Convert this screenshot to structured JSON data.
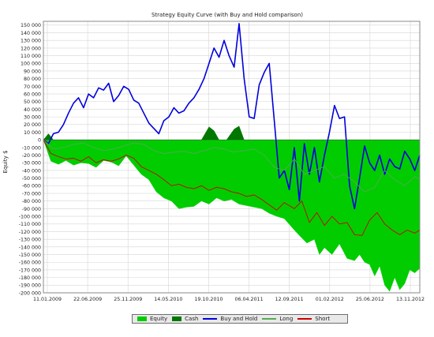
{
  "chart_data": {
    "type": "line",
    "title": "Strategy Equity Curve (with Buy and Hold comparison)",
    "ylabel": "Equity $",
    "xlabel": "",
    "ylim": [
      -200000,
      155000
    ],
    "yticks": [
      150000,
      140000,
      130000,
      120000,
      110000,
      100000,
      90000,
      80000,
      70000,
      60000,
      50000,
      40000,
      30000,
      20000,
      10000,
      0,
      -10000,
      -20000,
      -30000,
      -40000,
      -50000,
      -60000,
      -70000,
      -80000,
      -90000,
      -100000,
      -110000,
      -120000,
      -130000,
      -140000,
      -150000,
      -160000,
      -170000,
      -180000,
      -190000,
      -200000
    ],
    "ytick_labels": [
      "150 000",
      "140 000",
      "130 000",
      "120 000",
      "110 000",
      "100 000",
      "90 000",
      "80 000",
      "70 000",
      "60 000",
      "50 000",
      "40 000",
      "30 000",
      "20 000",
      "10 000",
      "0",
      "-10 000",
      "-20 000",
      "-30 000",
      "-40 000",
      "-50 000",
      "-60 000",
      "-70 000",
      "-80 000",
      "-90 000",
      "-100 000",
      "-110 000",
      "-120 000",
      "-130 000",
      "-140 000",
      "-150 000",
      "-160 000",
      "-170 000",
      "-180 000",
      "-190 000",
      "-200 000"
    ],
    "xticks": [
      "11.01.2009",
      "22.06.2009",
      "25.11.2009",
      "14.05.2010",
      "19.10.2010",
      "06.04.2011",
      "12.09.2011",
      "01.02.2012",
      "25.06.2012",
      "13.11.2012"
    ],
    "grid": true,
    "legend_position": "bottom",
    "series": [
      {
        "name": "Equity",
        "kind": "area",
        "color": "#00cc00",
        "x": [
          0,
          3,
          6,
          9,
          12,
          15,
          18,
          21,
          24,
          27,
          30,
          33,
          36,
          39,
          42,
          45,
          48,
          51,
          54,
          57,
          60,
          63,
          66,
          69,
          72,
          75,
          78,
          81,
          84,
          87,
          90,
          93,
          96,
          100,
          102,
          105,
          108,
          110,
          112,
          115,
          118,
          121,
          124,
          126,
          128,
          130,
          132,
          134,
          136,
          138,
          140,
          142,
          144,
          146,
          148,
          150
        ],
        "y": [
          0,
          -28000,
          -32000,
          -27000,
          -33000,
          -30000,
          -31000,
          -36000,
          -27000,
          -29000,
          -34000,
          -21000,
          -33000,
          -45000,
          -52000,
          -68000,
          -76000,
          -80000,
          -90000,
          -88000,
          -87000,
          -80000,
          -84000,
          -76000,
          -80000,
          -78000,
          -84000,
          -86000,
          -88000,
          -90000,
          -96000,
          -100000,
          -103000,
          -118000,
          -125000,
          -135000,
          -130000,
          -150000,
          -141000,
          -150000,
          -136000,
          -155000,
          -158000,
          -150000,
          -160000,
          -163000,
          -178000,
          -165000,
          -190000,
          -198000,
          -180000,
          -196000,
          -188000,
          -170000,
          -174000,
          -168000
        ]
      },
      {
        "name": "Cash",
        "kind": "area",
        "color": "#007700",
        "x": [
          0,
          2,
          4,
          50,
          55,
          60,
          63,
          66,
          68,
          70,
          73,
          76,
          78,
          80,
          150
        ],
        "y": [
          0,
          8000,
          0,
          0,
          0,
          0,
          0,
          17000,
          12000,
          0,
          0,
          14000,
          18000,
          0,
          0
        ]
      },
      {
        "name": "Buy and Hold",
        "kind": "line",
        "color": "#0000dd",
        "x": [
          0,
          2,
          4,
          6,
          8,
          10,
          12,
          14,
          16,
          18,
          20,
          22,
          24,
          26,
          28,
          30,
          32,
          34,
          36,
          38,
          40,
          42,
          44,
          46,
          48,
          50,
          52,
          54,
          56,
          58,
          60,
          62,
          64,
          66,
          68,
          70,
          72,
          74,
          76,
          78,
          80,
          82,
          84,
          86,
          88,
          90,
          92,
          94,
          96,
          98,
          100,
          102,
          104,
          106,
          108,
          110,
          112,
          114,
          116,
          118,
          120,
          122,
          124,
          126,
          128,
          130,
          132,
          134,
          136,
          138,
          140,
          142,
          144,
          146,
          148,
          150
        ],
        "y": [
          0,
          -5000,
          8000,
          10000,
          20000,
          35000,
          48000,
          55000,
          42000,
          60000,
          55000,
          68000,
          65000,
          74000,
          50000,
          58000,
          70000,
          66000,
          52000,
          48000,
          35000,
          22000,
          15000,
          8000,
          25000,
          30000,
          42000,
          35000,
          38000,
          48000,
          55000,
          66000,
          80000,
          100000,
          120000,
          108000,
          130000,
          110000,
          95000,
          152000,
          80000,
          30000,
          28000,
          72000,
          88000,
          100000,
          25000,
          -50000,
          -40000,
          -65000,
          -10000,
          -80000,
          -5000,
          -45000,
          -10000,
          -55000,
          -20000,
          10000,
          45000,
          28000,
          30000,
          -60000,
          -90000,
          -50000,
          -8000,
          -30000,
          -40000,
          -20000,
          -45000,
          -25000,
          -35000,
          -38000,
          -15000,
          -25000,
          -40000,
          -20000
        ]
      },
      {
        "name": "Long",
        "kind": "line",
        "color": "#55aa55",
        "x": [
          0,
          4,
          8,
          12,
          16,
          20,
          24,
          28,
          32,
          36,
          40,
          44,
          48,
          52,
          56,
          60,
          64,
          68,
          72,
          76,
          80,
          84,
          88,
          92,
          96,
          100,
          104,
          108,
          112,
          116,
          120,
          124,
          128,
          132,
          136,
          140,
          144,
          148,
          150
        ],
        "y": [
          0,
          -12000,
          -10000,
          -6000,
          -4000,
          -10000,
          -14000,
          -12000,
          -8000,
          -4000,
          -6000,
          -14000,
          -18000,
          -16000,
          -15000,
          -18000,
          -14000,
          -10000,
          -12000,
          -16000,
          -14000,
          -12000,
          -20000,
          -36000,
          -40000,
          -25000,
          -45000,
          -40000,
          -35000,
          -50000,
          -45000,
          -55000,
          -68000,
          -62000,
          -40000,
          -52000,
          -60000,
          -48000,
          -52000
        ]
      },
      {
        "name": "Short",
        "kind": "line",
        "color": "#cc0000",
        "x": [
          0,
          3,
          6,
          9,
          12,
          15,
          18,
          21,
          24,
          27,
          30,
          33,
          36,
          39,
          42,
          45,
          48,
          51,
          54,
          57,
          60,
          63,
          66,
          69,
          72,
          75,
          78,
          81,
          84,
          87,
          90,
          93,
          96,
          100,
          103,
          106,
          109,
          112,
          115,
          118,
          121,
          124,
          127,
          130,
          133,
          136,
          139,
          142,
          145,
          148,
          150
        ],
        "y": [
          0,
          -18000,
          -22000,
          -25000,
          -24000,
          -28000,
          -22000,
          -30000,
          -26000,
          -28000,
          -25000,
          -20000,
          -24000,
          -35000,
          -40000,
          -45000,
          -52000,
          -60000,
          -58000,
          -62000,
          -64000,
          -60000,
          -66000,
          -62000,
          -64000,
          -68000,
          -70000,
          -74000,
          -72000,
          -78000,
          -85000,
          -92000,
          -82000,
          -90000,
          -80000,
          -108000,
          -95000,
          -112000,
          -100000,
          -110000,
          -108000,
          -124000,
          -125000,
          -105000,
          -95000,
          -110000,
          -118000,
          -124000,
          -118000,
          -122000,
          -118000
        ]
      }
    ]
  },
  "legend": {
    "items": [
      "Equity",
      "Cash",
      "Buy and Hold",
      "Long",
      "Short"
    ]
  },
  "colors": {
    "equity": "#00cc00",
    "cash": "#007700",
    "buy_and_hold": "#0000dd",
    "long": "#55aa55",
    "short": "#cc0000"
  }
}
